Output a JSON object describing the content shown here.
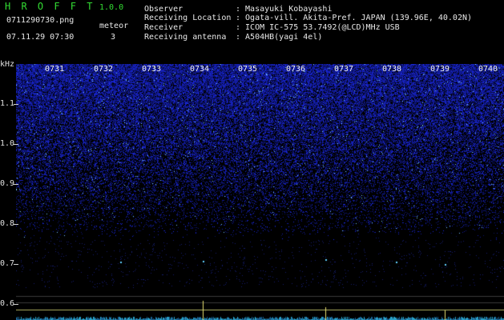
{
  "app": {
    "title": "H R O F F T",
    "version": "1.0.0",
    "filename": "0711290730.png",
    "datetime": "07.11.29 07:30",
    "meteor_label": "meteor",
    "meteor_count": "3"
  },
  "info": {
    "observer_label": "Observer",
    "observer_value": ": Masayuki Kobayashi",
    "location_label": "Receiving Location",
    "location_value": ": Ogata-vill. Akita-Pref. JAPAN (139.96E, 40.02N)",
    "receiver_label": "Receiver",
    "receiver_value": ": ICOM IC-575 53.7492(@LCD)MHz USB",
    "antenna_label": "Receiving antenna",
    "antenna_value": ": A504HB(yagi 4el)"
  },
  "spectrogram": {
    "y_unit": "kHz",
    "y_ticks": [
      "1.1",
      "1.0",
      "0.9",
      "0.8",
      "0.7",
      "0.6"
    ],
    "minutes": [
      "0731",
      "0732",
      "0733",
      "0734",
      "0735",
      "0736",
      "0737",
      "0738",
      "0739",
      "0740"
    ],
    "colors": {
      "background": "#000000",
      "noise": "#1f2fd0",
      "bright": "#6fd0ff",
      "label": "#33dd33"
    }
  }
}
